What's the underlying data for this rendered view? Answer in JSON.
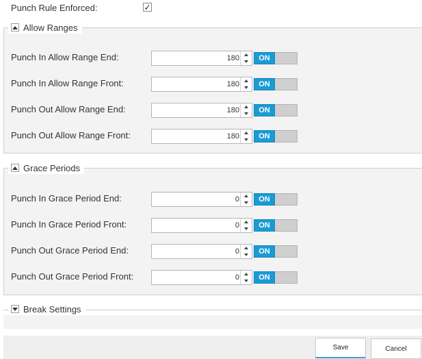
{
  "punch_rule": {
    "label": "Punch Rule Enforced:",
    "checked_glyph": "✓"
  },
  "allow_ranges": {
    "title": "Allow Ranges",
    "rows": [
      {
        "label": "Punch In Allow Range End:",
        "value": "180",
        "toggle": "ON"
      },
      {
        "label": "Punch In Allow Range Front:",
        "value": "180",
        "toggle": "ON"
      },
      {
        "label": "Punch Out Allow Range End:",
        "value": "180",
        "toggle": "ON"
      },
      {
        "label": "Punch Out Allow Range Front:",
        "value": "180",
        "toggle": "ON"
      }
    ]
  },
  "grace_periods": {
    "title": "Grace Periods",
    "rows": [
      {
        "label": "Punch In Grace Period End:",
        "value": "0",
        "toggle": "ON"
      },
      {
        "label": "Punch In Grace Period Front:",
        "value": "0",
        "toggle": "ON"
      },
      {
        "label": "Punch Out Grace Period End:",
        "value": "0",
        "toggle": "ON"
      },
      {
        "label": "Punch Out Grace Period Front:",
        "value": "0",
        "toggle": "ON"
      }
    ]
  },
  "break_settings": {
    "title": "Break Settings"
  },
  "footer": {
    "save_label": "Save",
    "cancel_label": "Cancel"
  },
  "colors": {
    "toggle_on": "#1a9bd4",
    "toggle_off": "#cfcfcf",
    "save_accent": "#3a9fd6"
  }
}
